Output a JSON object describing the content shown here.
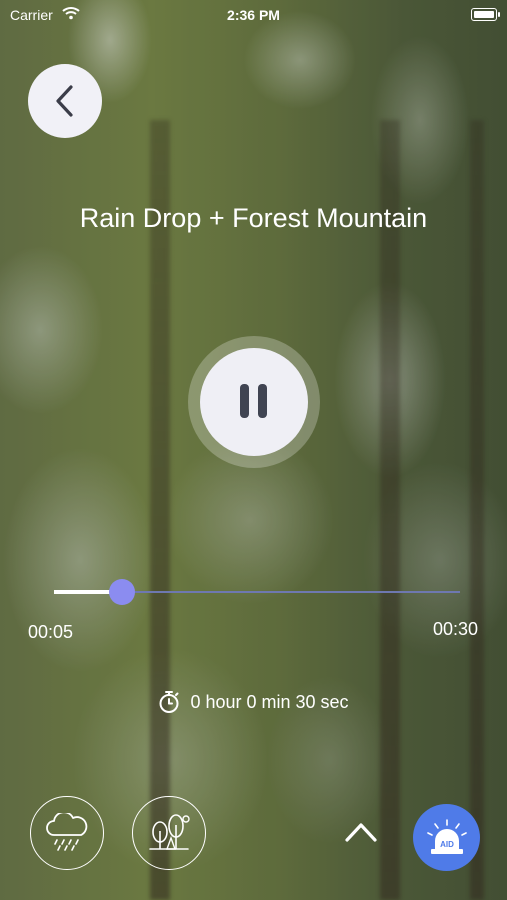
{
  "status_bar": {
    "carrier": "Carrier",
    "time": "2:36 PM"
  },
  "player": {
    "title": "Rain Drop + Forest Mountain",
    "elapsed": "00:05",
    "duration": "00:30",
    "progress_fraction": 0.167,
    "timer_label": "0 hour 0 min 30 sec",
    "state": "playing"
  },
  "bottom_bar": {
    "aid_label": "AID"
  },
  "icons": {
    "back": "chevron-left-icon",
    "pause": "pause-icon",
    "timer": "stopwatch-icon",
    "rain": "rain-cloud-icon",
    "forest": "forest-icon",
    "expand": "chevron-up-icon",
    "aid": "siren-icon"
  },
  "colors": {
    "accent": "#8b8cf0",
    "aid_button": "#4f7be8",
    "control_bg": "#efeff5"
  }
}
